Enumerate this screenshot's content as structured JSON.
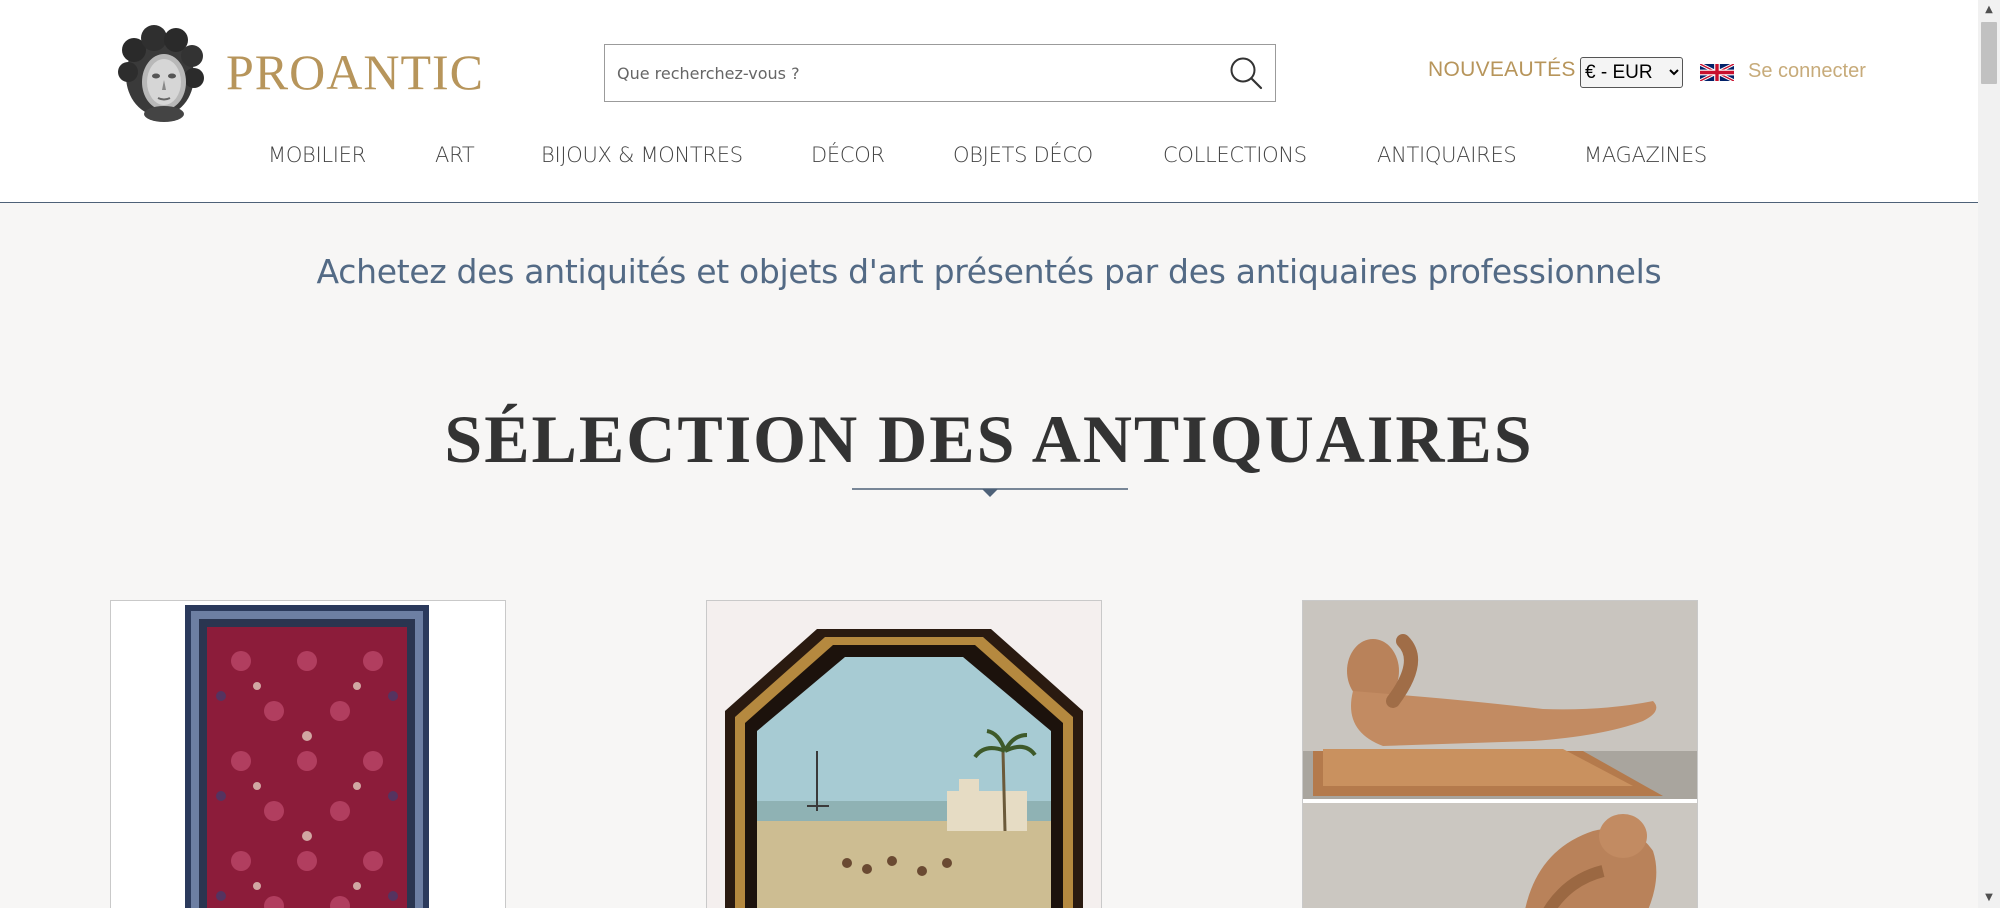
{
  "header": {
    "logo_text": "PROANTIC",
    "search": {
      "placeholder": "Que recherchez-vous ?"
    },
    "new_label": "NOUVEAUTÉS",
    "currency": {
      "selected": "€ - EUR",
      "options": [
        "€ - EUR"
      ]
    },
    "language_icon": "uk-flag-icon",
    "login_label": "Se connecter"
  },
  "nav": {
    "items": [
      {
        "label": "MOBILIER"
      },
      {
        "label": "ART"
      },
      {
        "label": "BIJOUX & MONTRES"
      },
      {
        "label": "DÉCOR"
      },
      {
        "label": "OBJETS DÉCO"
      },
      {
        "label": "COLLECTIONS"
      },
      {
        "label": "ANTIQUAIRES"
      },
      {
        "label": "MAGAZINES"
      }
    ]
  },
  "main": {
    "tagline": "Achetez des antiquités et objets d'art présentés par des antiquaires professionnels",
    "section_title": "SÉLECTION DES ANTIQUAIRES",
    "cards": [
      {
        "image_icon": "persian-rug-image"
      },
      {
        "image_icon": "octagonal-framed-painting-image"
      },
      {
        "image_icon": "terracotta-reclining-figure-image"
      }
    ]
  },
  "colors": {
    "brand_gold": "#b7955b",
    "accent_blue": "#536a85",
    "page_background": "#f7f6f5"
  }
}
